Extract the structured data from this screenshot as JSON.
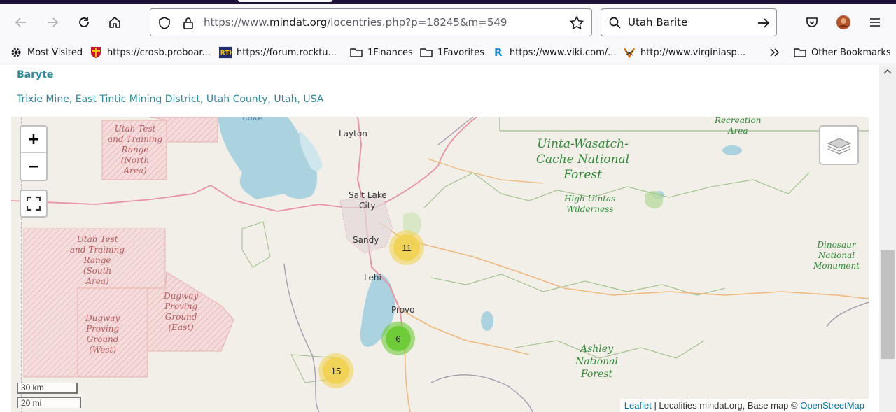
{
  "browser": {
    "url_prefix": "https://www.",
    "url_domain": "mindat.org",
    "url_path": "/locentries.php?p=18245&m=549",
    "search_query": "Utah Barite"
  },
  "bookmarks": [
    {
      "label": "Most Visited",
      "icon": "gear-icon"
    },
    {
      "label": "https://crosb.proboar...",
      "icon": "shield-crest-icon"
    },
    {
      "label": "https://forum.rocktu...",
      "icon": "rth-logo-icon"
    },
    {
      "label": "1Finances",
      "icon": "folder-icon"
    },
    {
      "label": "1Favorites",
      "icon": "folder-icon"
    },
    {
      "label": "https://www.viki.com/...",
      "icon": "viki-r-icon"
    },
    {
      "label": "http://www.virginiasp...",
      "icon": "v-logo-icon"
    },
    {
      "label": "Other Bookmarks",
      "icon": "folder-icon"
    }
  ],
  "page": {
    "mineral": "Baryte",
    "locality": "Trixie Mine, East Tintic Mining District, Utah County, Utah, USA"
  },
  "map": {
    "zoom_in": "+",
    "zoom_out": "−",
    "clusters": [
      {
        "count": "11",
        "color": "#f1d357"
      },
      {
        "count": "6",
        "color": "#6ecc39"
      },
      {
        "count": "15",
        "color": "#f1d357"
      }
    ],
    "areas": {
      "north": [
        "Utah Test",
        "and Training",
        "Range",
        "(North",
        "Area)"
      ],
      "south": [
        "Utah Test",
        "and Training",
        "Range",
        "(South",
        "Area)"
      ],
      "dugway_west": [
        "Dugway",
        "Proving",
        "Ground",
        "(West)"
      ],
      "dugway_east": [
        "Dugway",
        "Proving",
        "Ground",
        "(East)"
      ],
      "uinta": [
        "Uinta-Wasatch-",
        "Cache National",
        "Forest"
      ],
      "high_uintas": [
        "High Uintas",
        "Wilderness"
      ],
      "ashley": [
        "Ashley",
        "National",
        "Forest"
      ],
      "dinosaur": [
        "Dinosaur",
        "National",
        "Monument"
      ],
      "recreation": [
        "Recreation",
        "Area"
      ],
      "lake": "Lake"
    },
    "cities": [
      "Layton",
      "Salt Lake",
      "City",
      "Sandy",
      "Lehi",
      "Provo"
    ],
    "scale_km": "30 km",
    "scale_mi": "20 mi",
    "attribution": {
      "leaflet": "Leaflet",
      "middle": " | Localities mindat.org, Base map © ",
      "osm": "OpenStreetMap"
    }
  }
}
